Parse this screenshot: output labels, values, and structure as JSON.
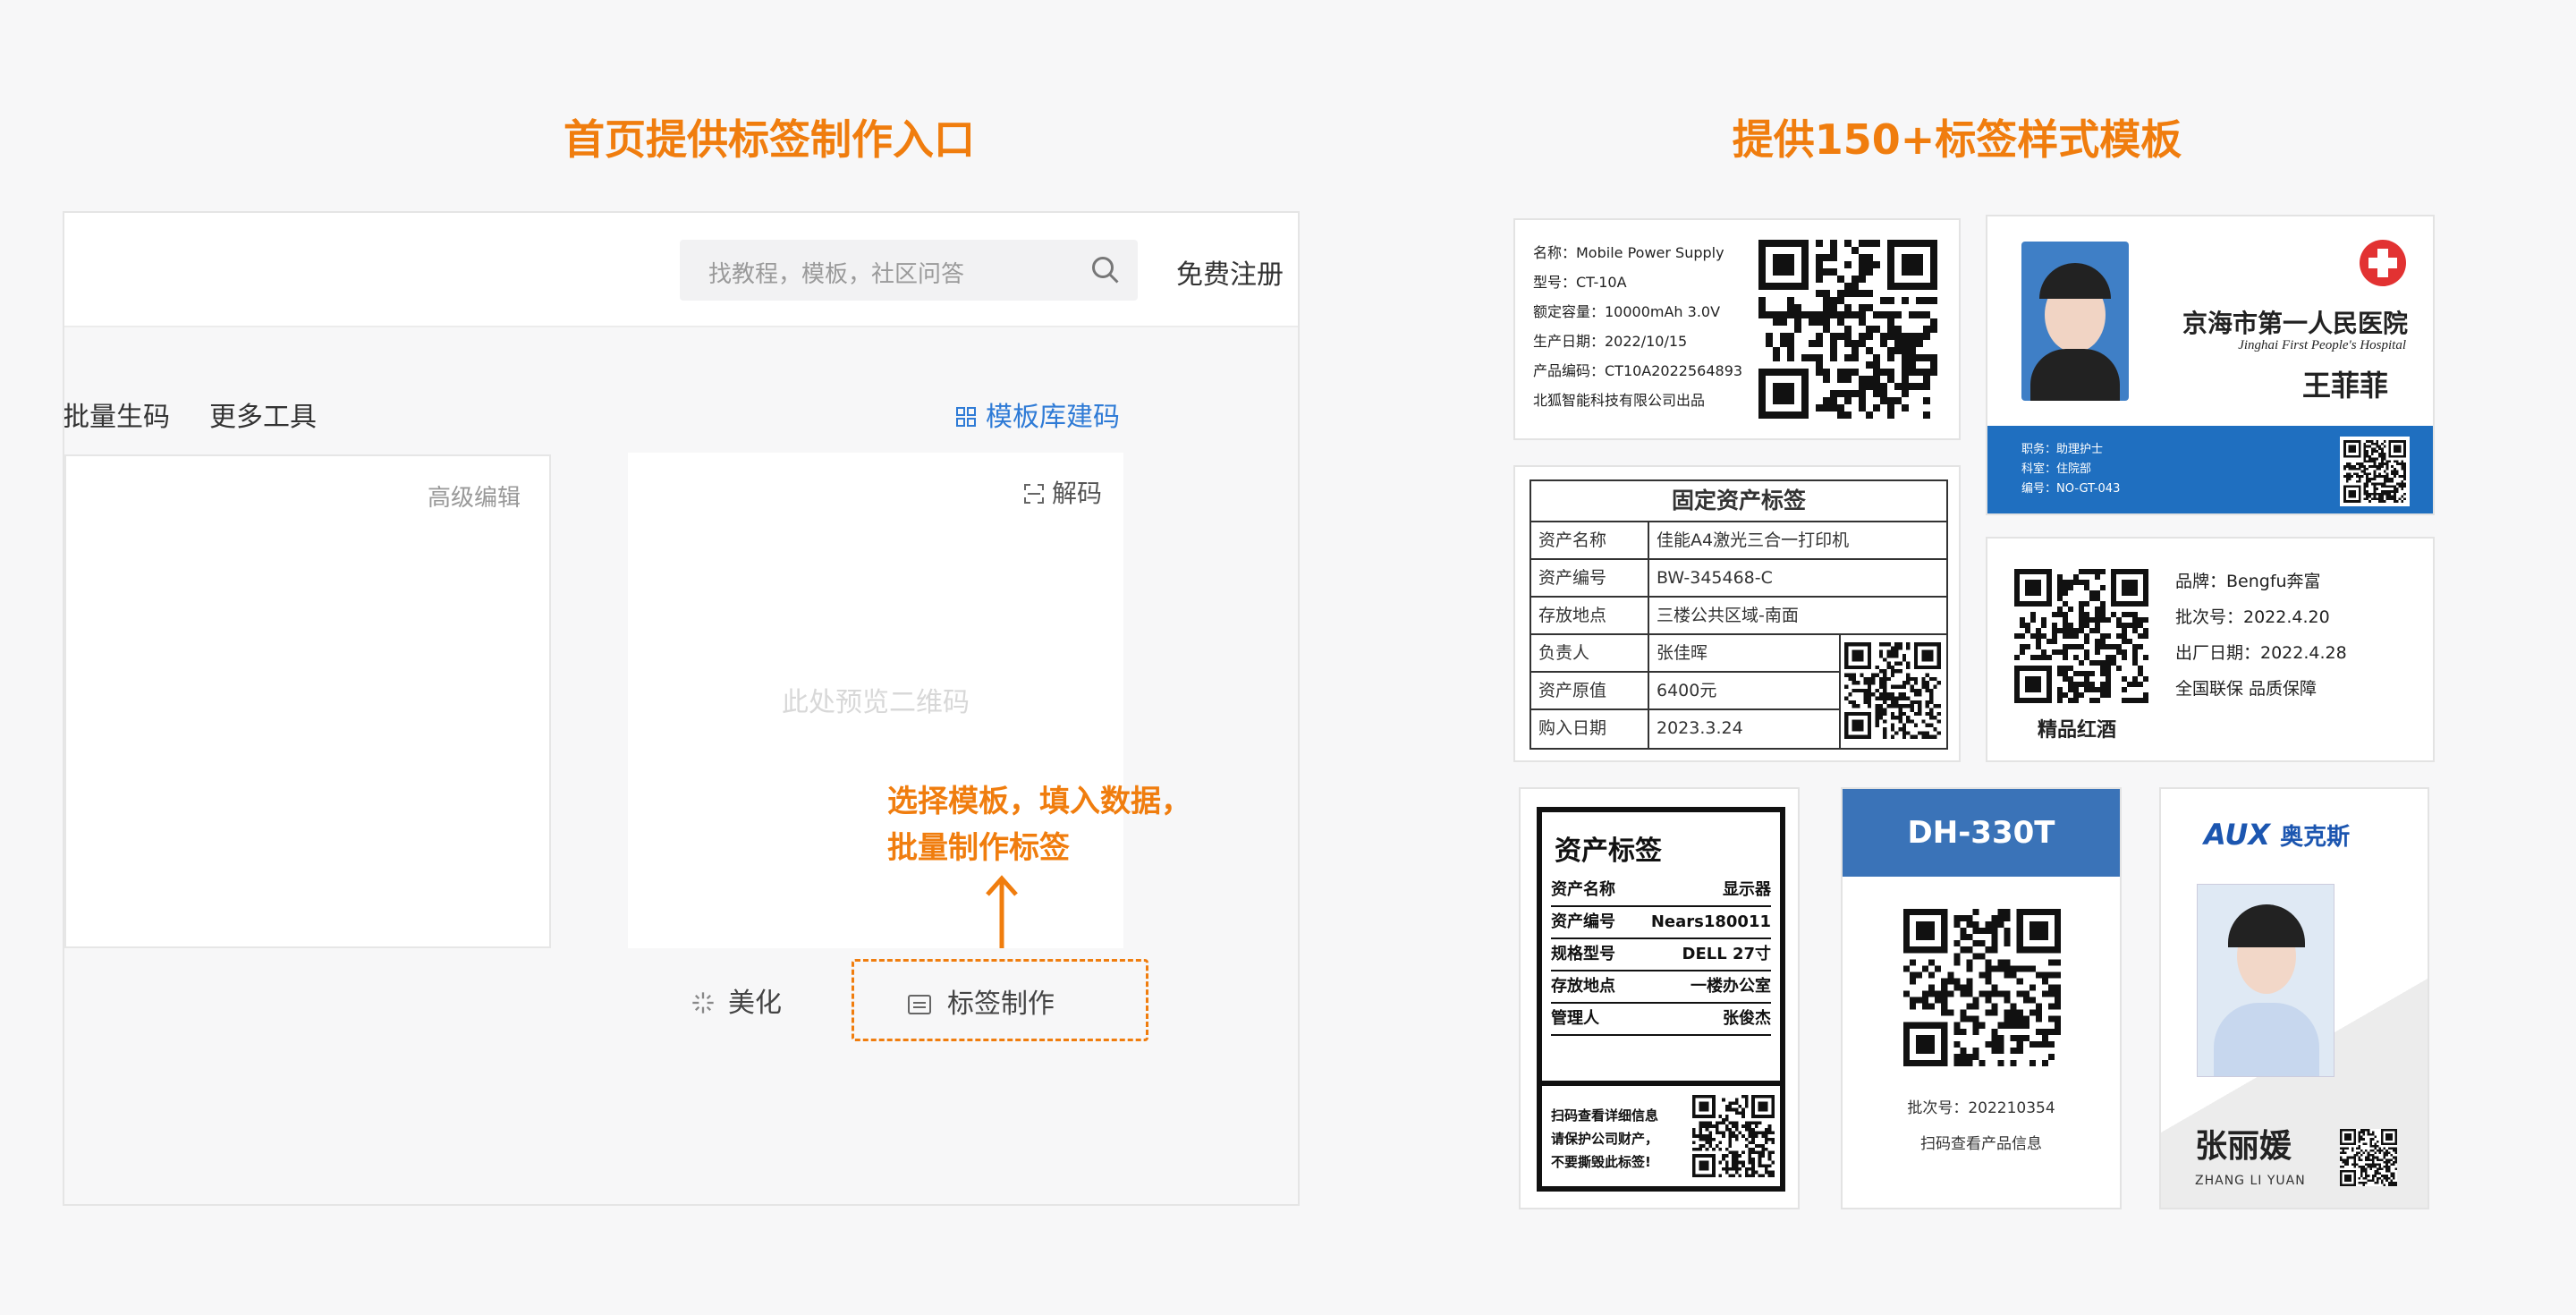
{
  "headings": {
    "left": "首页提供标签制作入口",
    "right": "提供150+标签样式模板"
  },
  "mock": {
    "search_placeholder": "找教程，模板，社区问答",
    "search_icon": "search-icon",
    "register_label": "免费注册",
    "nav_batch": "批量生码",
    "nav_more": "更多工具",
    "template_button": "模板库建码",
    "advanced_edit": "高级编辑",
    "decode_label": "解码",
    "preview_placeholder": "此处预览二维码",
    "hint_line1": "选择模板，填入数据，",
    "hint_line2": "批量制作标签",
    "beautify_label": "美化",
    "label_make": "标签制作",
    "accent_color": "#f07d0e",
    "link_color": "#2f7bd6"
  },
  "cards": {
    "power": {
      "name": "名称：Mobile Power Supply",
      "model": "型号：CT-10A",
      "capacity": "额定容量：10000mAh 3.0V",
      "date": "生产日期：2022/10/15",
      "code": "产品编码：CT10A2022564893",
      "maker": "北狐智能科技有限公司出品"
    },
    "badge": {
      "hospital_cn": "京海市第一人民医院",
      "hospital_en": "Jinghai First People's Hospital",
      "name": "王菲菲",
      "role": "职务：助理护士",
      "dept": "科室：住院部",
      "number": "编号：NO-GT-043",
      "band_color": "#1f6fc0"
    },
    "fixed_asset": {
      "title": "固定资产标签",
      "rows": [
        [
          "资产名称",
          "佳能A4激光三合一打印机"
        ],
        [
          "资产编号",
          "BW-345468-C"
        ],
        [
          "存放地点",
          "三楼公共区域-南面"
        ],
        [
          "负责人",
          "张佳晖"
        ],
        [
          "资产原值",
          "6400元"
        ],
        [
          "购入日期",
          "2023.3.24"
        ]
      ]
    },
    "wine": {
      "brand": "品牌：Bengfu奔富",
      "batch": "批次号：2022.4.20",
      "date": "出厂日期：2022.4.28",
      "warranty": "全国联保 品质保障",
      "caption": "精品红酒"
    },
    "asset2": {
      "title": "资产标签",
      "rows": [
        [
          "资产名称",
          "显示器"
        ],
        [
          "资产编号",
          "Nears180011"
        ],
        [
          "规格型号",
          "DELL 27寸"
        ],
        [
          "存放地点",
          "一楼办公室"
        ],
        [
          "管理人",
          "张俊杰"
        ]
      ],
      "note1": "扫码查看详细信息",
      "note2": "请保护公司财产，",
      "note3": "不要撕毁此标签!"
    },
    "product": {
      "title": "DH-330T",
      "batch": "批次号：202210354",
      "note": "扫码查看产品信息",
      "header_color": "#3a73b8"
    },
    "aux": {
      "logo_en": "AUX",
      "logo_cn": "奥克斯",
      "name": "张丽媛",
      "pinyin": "ZHANG LI YUAN"
    }
  }
}
